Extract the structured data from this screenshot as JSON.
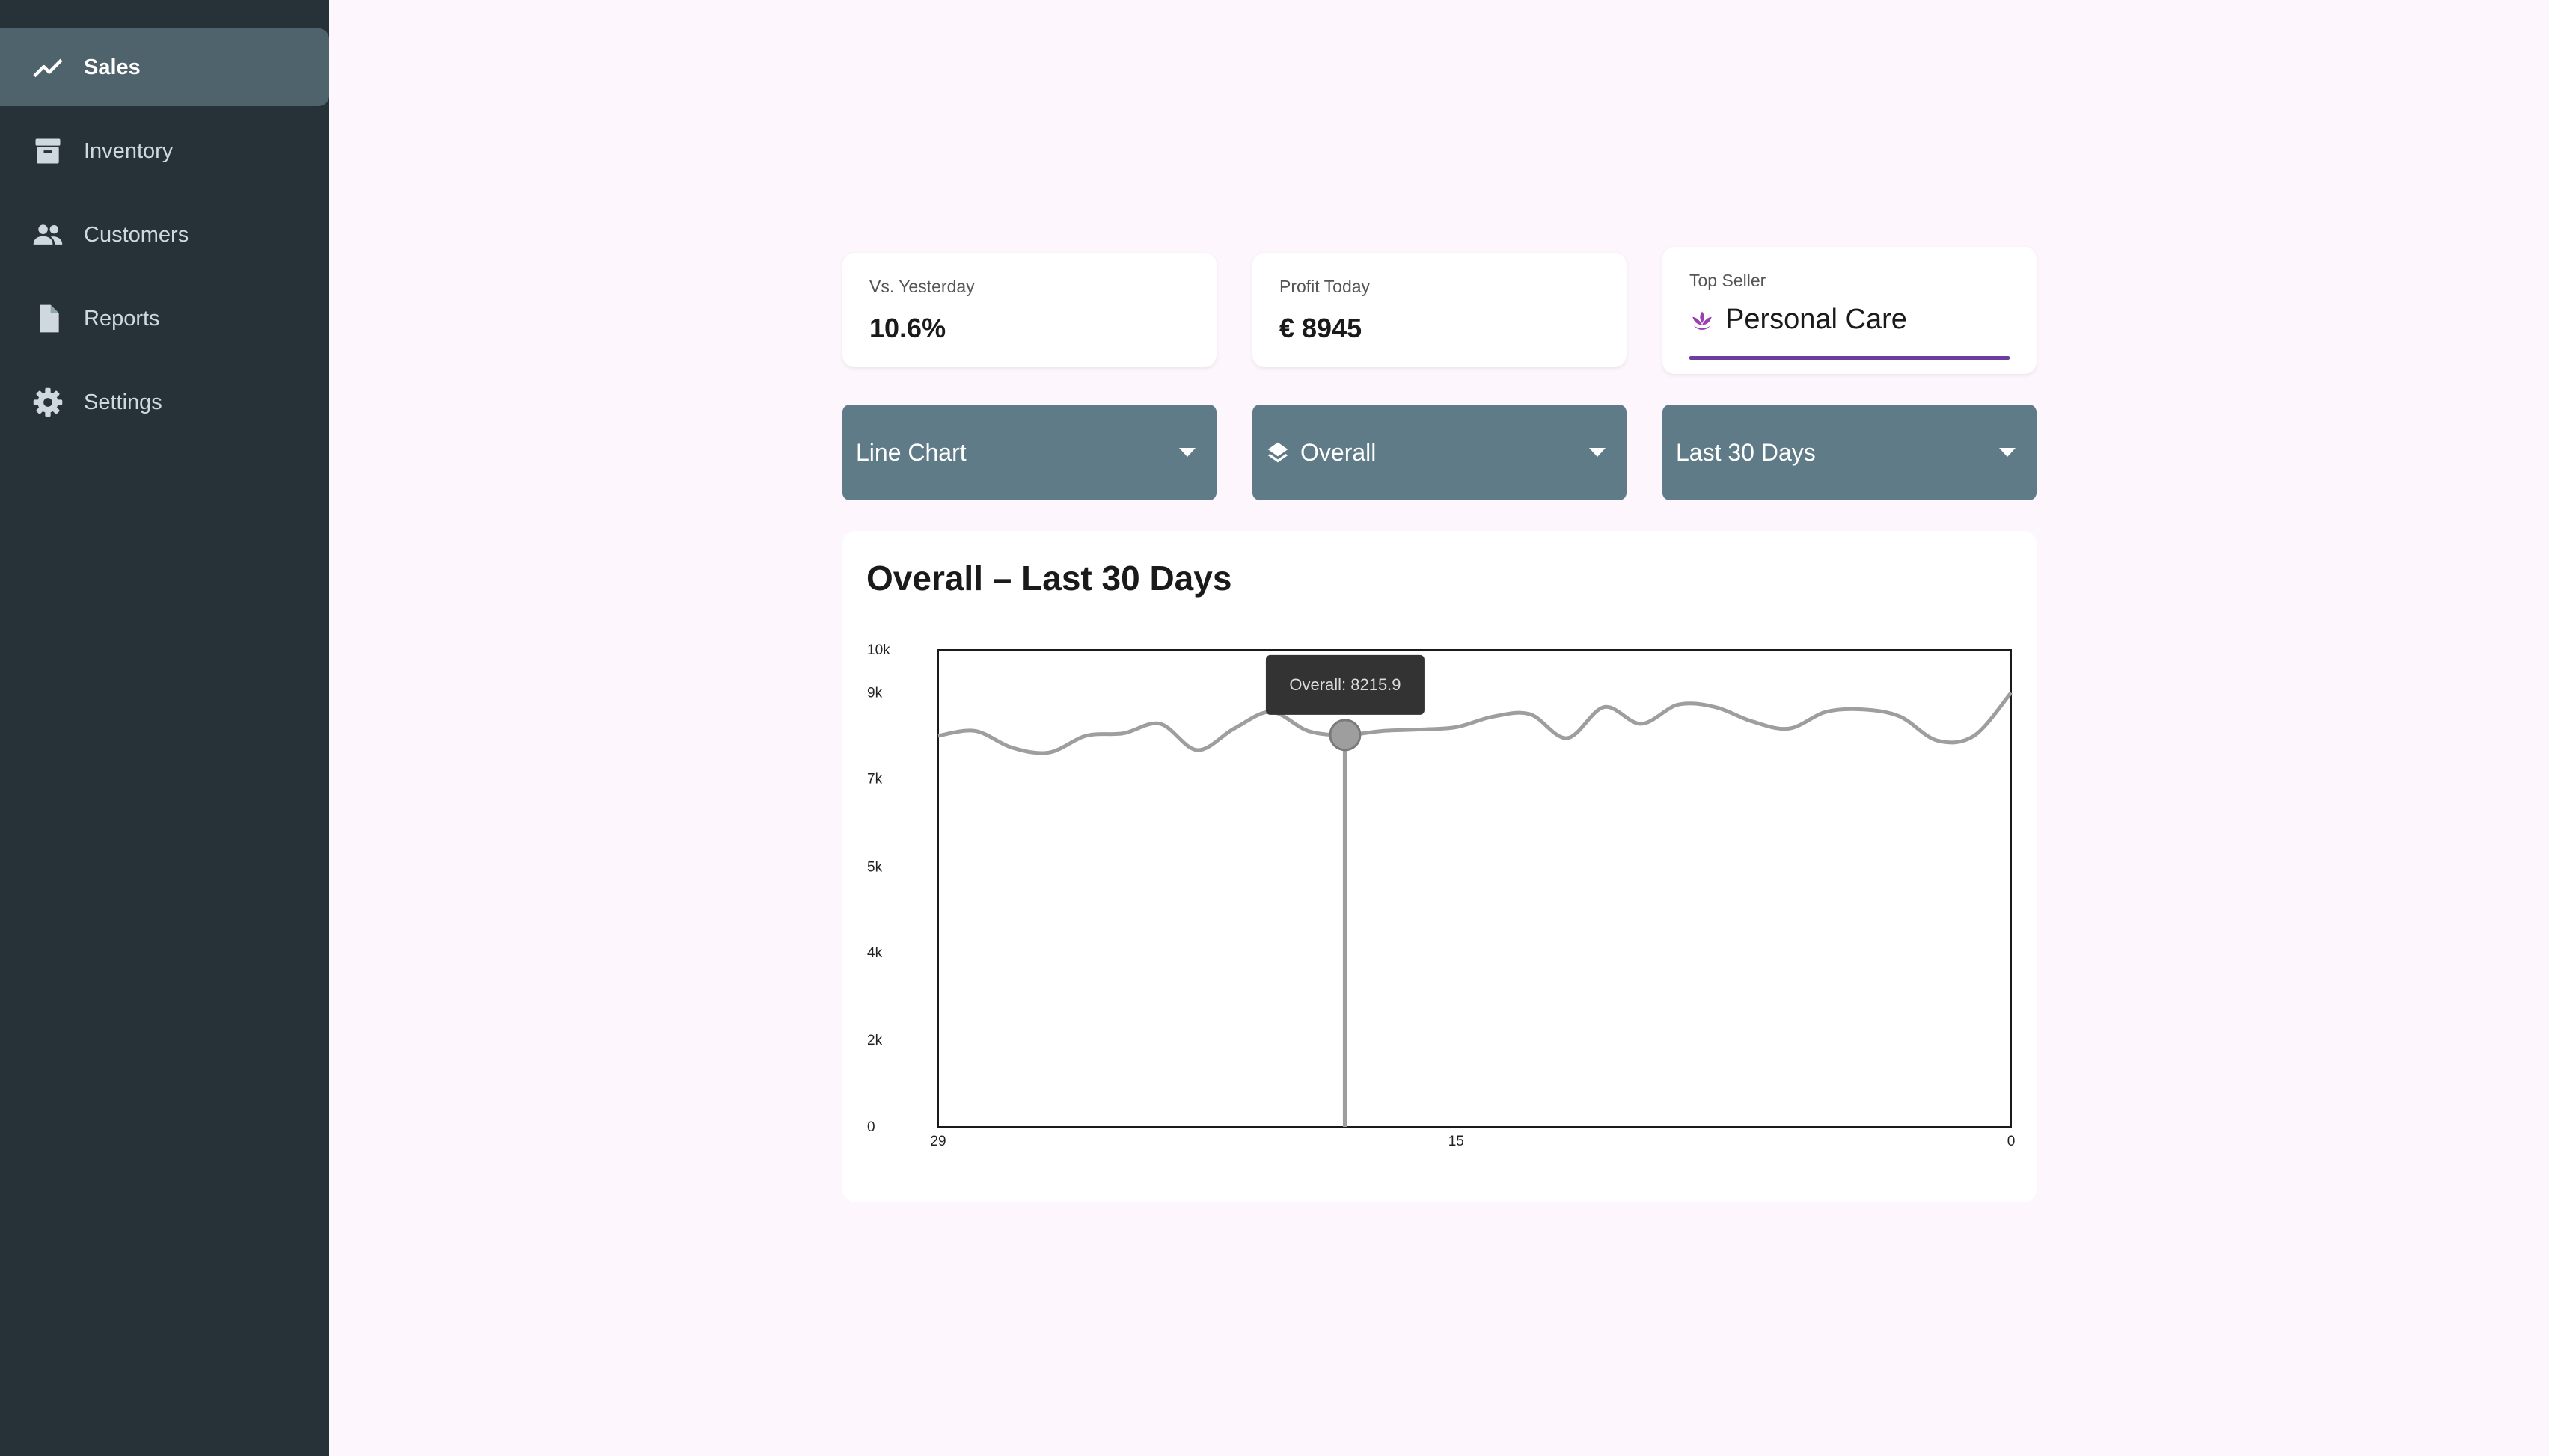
{
  "sidebar": {
    "items": [
      {
        "label": "Sales",
        "icon": "trending-up-icon",
        "active": true
      },
      {
        "label": "Inventory",
        "icon": "archive-icon",
        "active": false
      },
      {
        "label": "Customers",
        "icon": "people-icon",
        "active": false
      },
      {
        "label": "Reports",
        "icon": "document-icon",
        "active": false
      },
      {
        "label": "Settings",
        "icon": "gear-icon",
        "active": false
      }
    ]
  },
  "stats": {
    "vs_yesterday": {
      "label": "Vs. Yesterday",
      "value": "10.6%"
    },
    "profit_today": {
      "label": "Profit Today",
      "value": "€ 8945"
    },
    "top_seller": {
      "label": "Top Seller",
      "value": "Personal Care",
      "icon": "lotus-icon"
    }
  },
  "controls": {
    "chart_type": "Line Chart",
    "category": "Overall",
    "period": "Last 30 Days"
  },
  "colors": {
    "sidebar_bg": "#263238",
    "active_item_bg": "#4f636c",
    "dropdown_bg": "#5f7b87",
    "accent_underline": "#6a3fa0",
    "lotus_icon": "#9c3db0",
    "line": "#9e9e9e",
    "tooltip_bg": "#333333"
  },
  "chart": {
    "title": "Overall – Last 30 Days",
    "tooltip": "Overall: 8215.9"
  },
  "chart_data": {
    "type": "line",
    "title": "Overall – Last 30 Days",
    "xlabel": "",
    "ylabel": "",
    "xlim": [
      29,
      0
    ],
    "ylim": [
      0,
      10000
    ],
    "x_ticks": [
      "29",
      "15",
      "0"
    ],
    "y_ticks": [
      {
        "label": "10k",
        "value": 10000
      },
      {
        "label": "9k",
        "value": 9100
      },
      {
        "label": "7k",
        "value": 7300
      },
      {
        "label": "5k",
        "value": 5450
      },
      {
        "label": "4k",
        "value": 3650
      },
      {
        "label": "2k",
        "value": 1820
      },
      {
        "label": "0",
        "value": 0
      }
    ],
    "grid": false,
    "series": [
      {
        "values": [
          {
            "x": 29,
            "y": 8200
          },
          {
            "x": 28,
            "y": 8300
          },
          {
            "x": 27,
            "y": 7950
          },
          {
            "x": 26,
            "y": 7850
          },
          {
            "x": 25,
            "y": 8200
          },
          {
            "x": 24,
            "y": 8250
          },
          {
            "x": 23,
            "y": 8450
          },
          {
            "x": 22,
            "y": 7900
          },
          {
            "x": 21,
            "y": 8350
          },
          {
            "x": 20,
            "y": 8700
          },
          {
            "x": 19,
            "y": 8300
          },
          {
            "x": 18,
            "y": 8215.9
          },
          {
            "x": 17,
            "y": 8300
          },
          {
            "x": 16,
            "y": 8330
          },
          {
            "x": 15,
            "y": 8380
          },
          {
            "x": 14,
            "y": 8600
          },
          {
            "x": 13,
            "y": 8650
          },
          {
            "x": 12,
            "y": 8150
          },
          {
            "x": 11,
            "y": 8800
          },
          {
            "x": 10,
            "y": 8450
          },
          {
            "x": 9,
            "y": 8850
          },
          {
            "x": 8,
            "y": 8800
          },
          {
            "x": 7,
            "y": 8500
          },
          {
            "x": 6,
            "y": 8350
          },
          {
            "x": 5,
            "y": 8700
          },
          {
            "x": 4,
            "y": 8750
          },
          {
            "x": 3,
            "y": 8600
          },
          {
            "x": 2,
            "y": 8100
          },
          {
            "x": 1,
            "y": 8200
          },
          {
            "x": 0,
            "y": 9100
          }
        ]
      }
    ],
    "highlight": {
      "x": 18,
      "y": 8215.9
    }
  }
}
